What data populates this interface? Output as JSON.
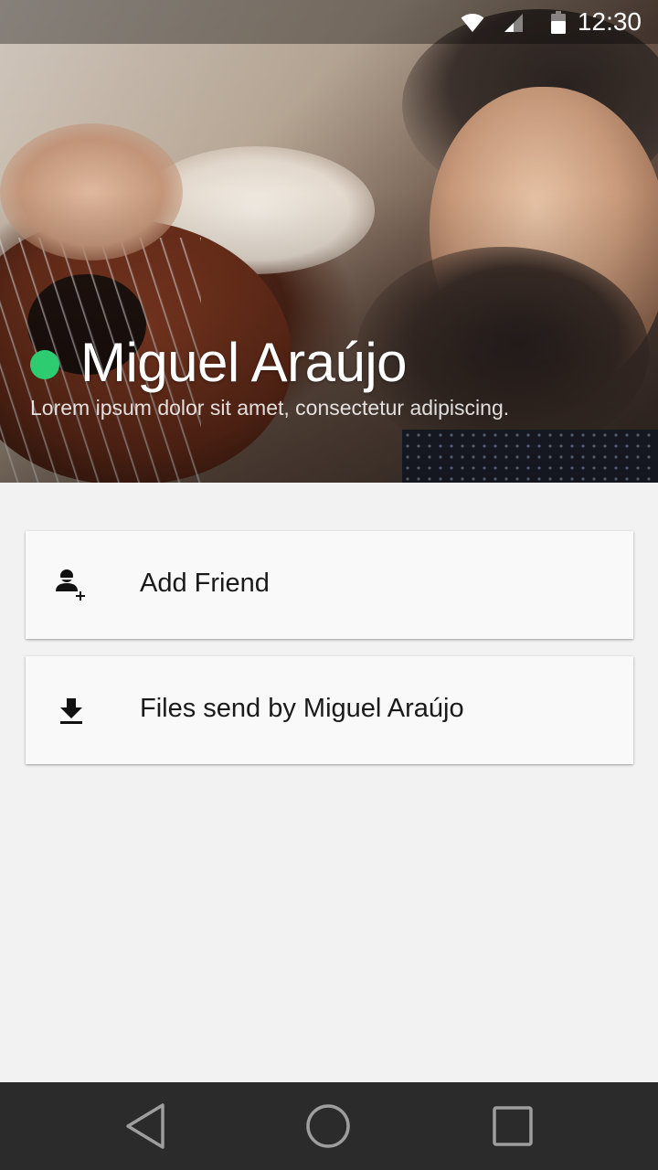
{
  "status_bar": {
    "time": "12:30",
    "icons": [
      "wifi-icon",
      "cell-signal-icon",
      "battery-icon"
    ]
  },
  "profile": {
    "name": "Miguel Araújo",
    "status_message": "Lorem ipsum dolor sit amet, consectetur adipiscing.",
    "online": true,
    "online_color": "#2ecc71"
  },
  "actions": [
    {
      "icon": "add-person-icon",
      "label": "Add Friend"
    },
    {
      "icon": "download-icon",
      "label": "Files send by Miguel Araújo"
    }
  ],
  "nav_bar": {
    "buttons": [
      "back-icon",
      "home-icon",
      "recents-icon"
    ]
  },
  "colors": {
    "background": "#f2f2f2",
    "card": "#f9f9f9",
    "nav_bar": "#2b2b2b"
  }
}
